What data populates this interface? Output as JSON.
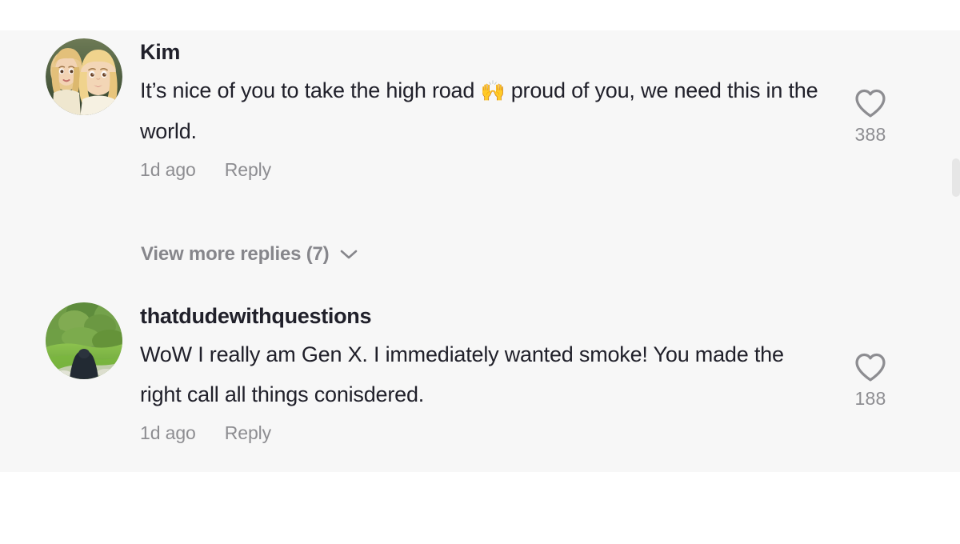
{
  "panel": {
    "background_color": "#f7f7f7",
    "page_background_color": "#ffffff"
  },
  "comments": [
    {
      "username": "Kim",
      "text": "It’s nice of you to take the high road 🙌 proud of you, we need this in the world.",
      "text_line1_prefix": "It’s nice of you to take the high road ",
      "emoji": "🙌",
      "text_line1_suffix": " proud of you,",
      "text_line2": "we need this in the world.",
      "timestamp": "1d ago",
      "reply_label": "Reply",
      "like_count": "388",
      "like_icon": "heart-icon",
      "avatar_alt": "two animated blonde characters"
    },
    {
      "username": "thatdudewithquestions",
      "text": "WoW I really am Gen X. I immediately wanted smoke! You made the right call all things conisdered.",
      "text_line1": "WoW I really am Gen X. I immediately wanted smoke!",
      "text_line2": "You made the right call all things conisdered.",
      "timestamp": "1d ago",
      "reply_label": "Reply",
      "like_count": "188",
      "like_icon": "heart-icon",
      "avatar_alt": "green garden scene with dark figure"
    }
  ],
  "view_more_replies": {
    "label": "View more replies (7)",
    "count": "7",
    "chevron_icon": "chevron-down-icon"
  },
  "colors": {
    "text_primary": "#20202a",
    "text_muted": "#8d8d91",
    "panel": "#f7f7f7",
    "scrollbar_thumb": "#e6e6e6"
  }
}
